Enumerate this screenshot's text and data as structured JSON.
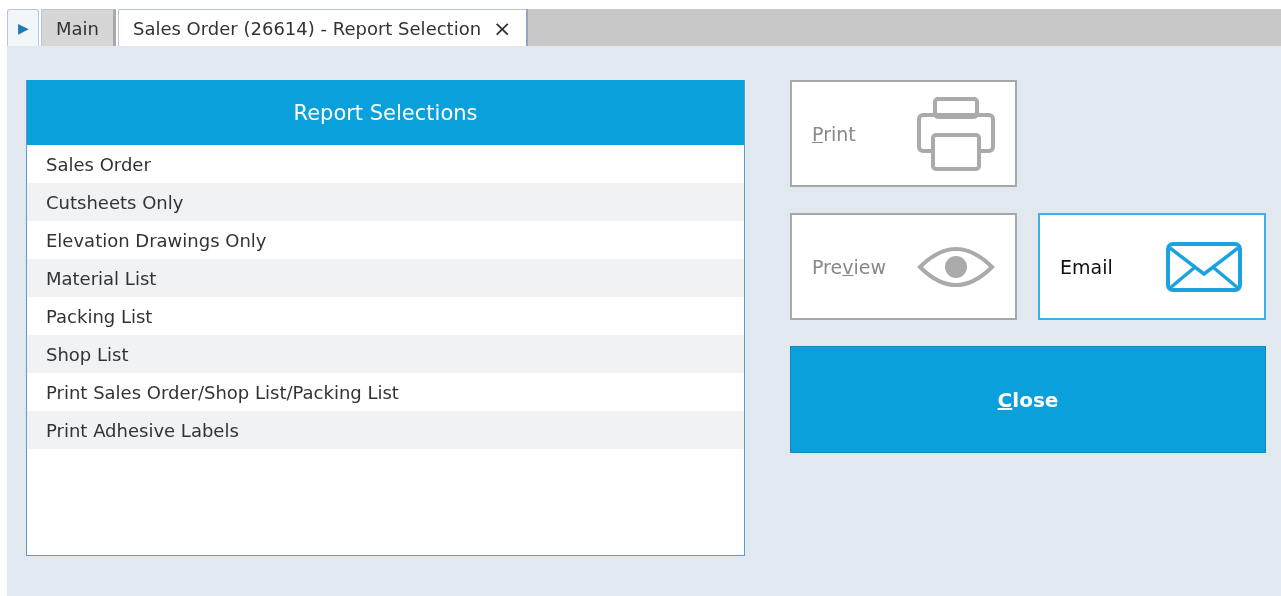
{
  "tab_bar": {
    "nav_arrow": "▶",
    "tabs": [
      {
        "label": "Main",
        "selected": false,
        "closable": false
      },
      {
        "label": "Sales Order (26614) - Report Selection",
        "selected": true,
        "closable": true,
        "close_glyph": "×"
      }
    ]
  },
  "report_list": {
    "title": "Report Selections",
    "items": [
      {
        "label": "Sales Order",
        "selected": false
      },
      {
        "label": "Cutsheets Only",
        "selected": false
      },
      {
        "label": "Elevation Drawings Only",
        "selected": false
      },
      {
        "label": "Material List",
        "selected": false
      },
      {
        "label": "Packing List",
        "selected": false
      },
      {
        "label": "Shop List",
        "selected": false
      },
      {
        "label": "Print Sales Order/Shop List/Packing List",
        "selected": false
      },
      {
        "label": "Print Adhesive Labels",
        "selected": false
      }
    ]
  },
  "actions": [
    {
      "access_key": "P",
      "text_after": "rint",
      "kind": "printer",
      "disabled": true
    },
    {
      "text_before": "Pre",
      "access_key": "v",
      "text_after": "iew",
      "kind": "eye",
      "disabled": true
    },
    {
      "text_before": "Email",
      "kind": "envelope",
      "disabled": false
    }
  ],
  "close_button": {
    "access_key": "C",
    "text_after": "lose"
  }
}
